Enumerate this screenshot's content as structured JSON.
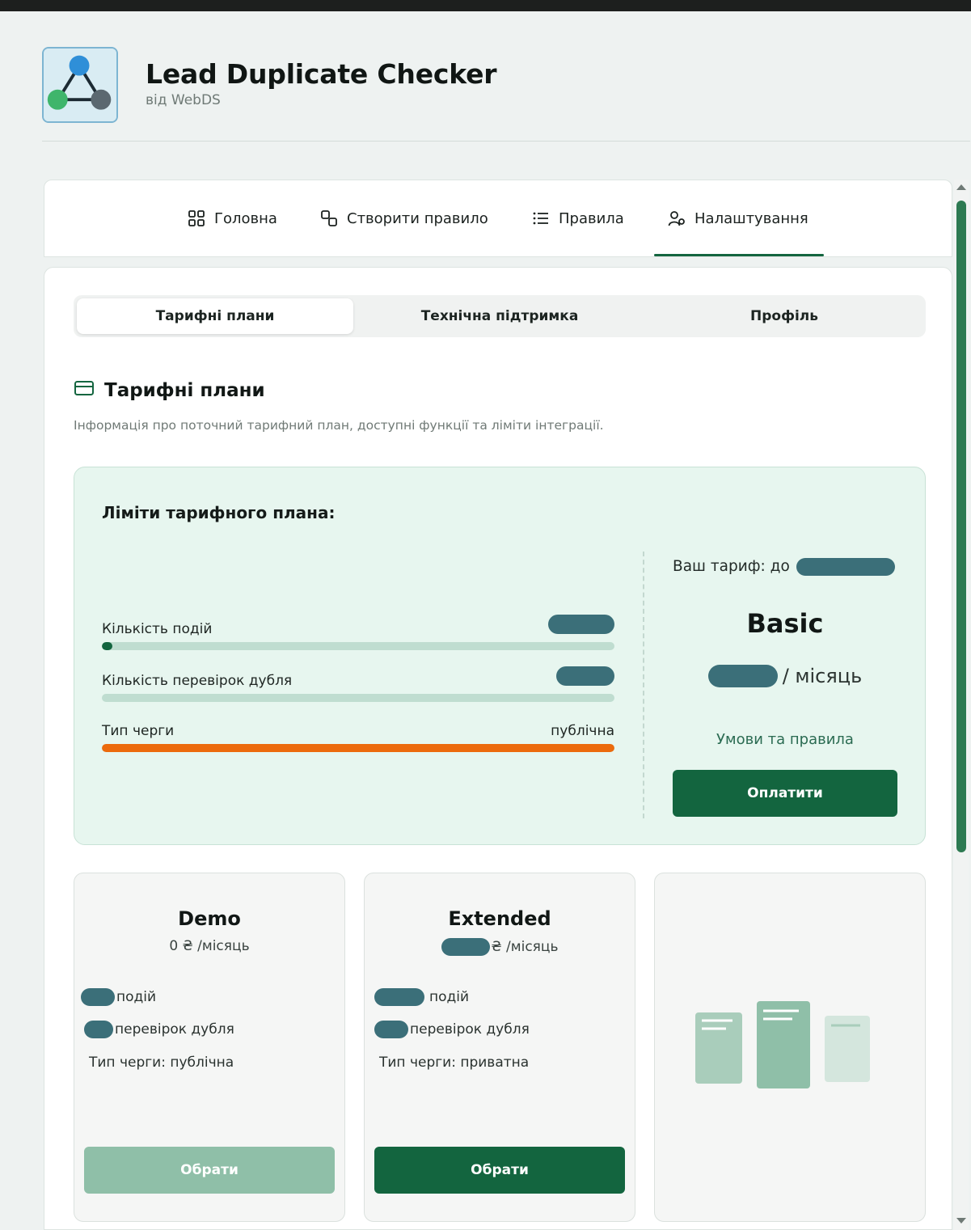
{
  "app": {
    "title": "Lead Duplicate Checker",
    "vendor": "від WebDS"
  },
  "nav": {
    "items": [
      {
        "label": "Головна",
        "icon": "grid-icon"
      },
      {
        "label": "Створити правило",
        "icon": "create-rule-icon"
      },
      {
        "label": "Правила",
        "icon": "list-icon"
      },
      {
        "label": "Налаштування",
        "icon": "user-settings-icon",
        "active": true
      }
    ]
  },
  "subtabs": [
    "Тарифні плани",
    "Технічна підтримка",
    "Профіль"
  ],
  "section": {
    "title": "Тарифні плани",
    "description": "Інформація про поточний тарифний план, доступні функції та ліміти інтеграції."
  },
  "limits": {
    "title": "Ліміти тарифного плана:",
    "rows": [
      {
        "label": "Кількість подій",
        "value": "",
        "progress": 0.02
      },
      {
        "label": "Кількість перевірок дубля",
        "value": "",
        "progress": 0.0
      },
      {
        "label": "Тип черги",
        "value": "публічна",
        "progress": 1.0
      }
    ]
  },
  "current_plan": {
    "prefix": "Ваш тариф: до",
    "name": "Basic",
    "price_suffix": "/ місяць",
    "terms_link": "Умови та правила",
    "pay_button": "Оплатити"
  },
  "plans": [
    {
      "name": "Demo",
      "price": "0 ₴ /місяць",
      "events": "подій",
      "checks": "перевірок дубля",
      "queue": "Тип черги: публічна",
      "button": "Обрати"
    },
    {
      "name": "Extended",
      "price": "₴ /місяць",
      "events": "подій",
      "checks": "перевірок дубля",
      "queue": "Тип черги: приватна",
      "button": "Обрати"
    }
  ],
  "colors": {
    "accent": "#13653f",
    "limits_bg": "#e7f6ef",
    "queue_bar": "#ec6a0c",
    "redaction": "#3b6f79"
  }
}
